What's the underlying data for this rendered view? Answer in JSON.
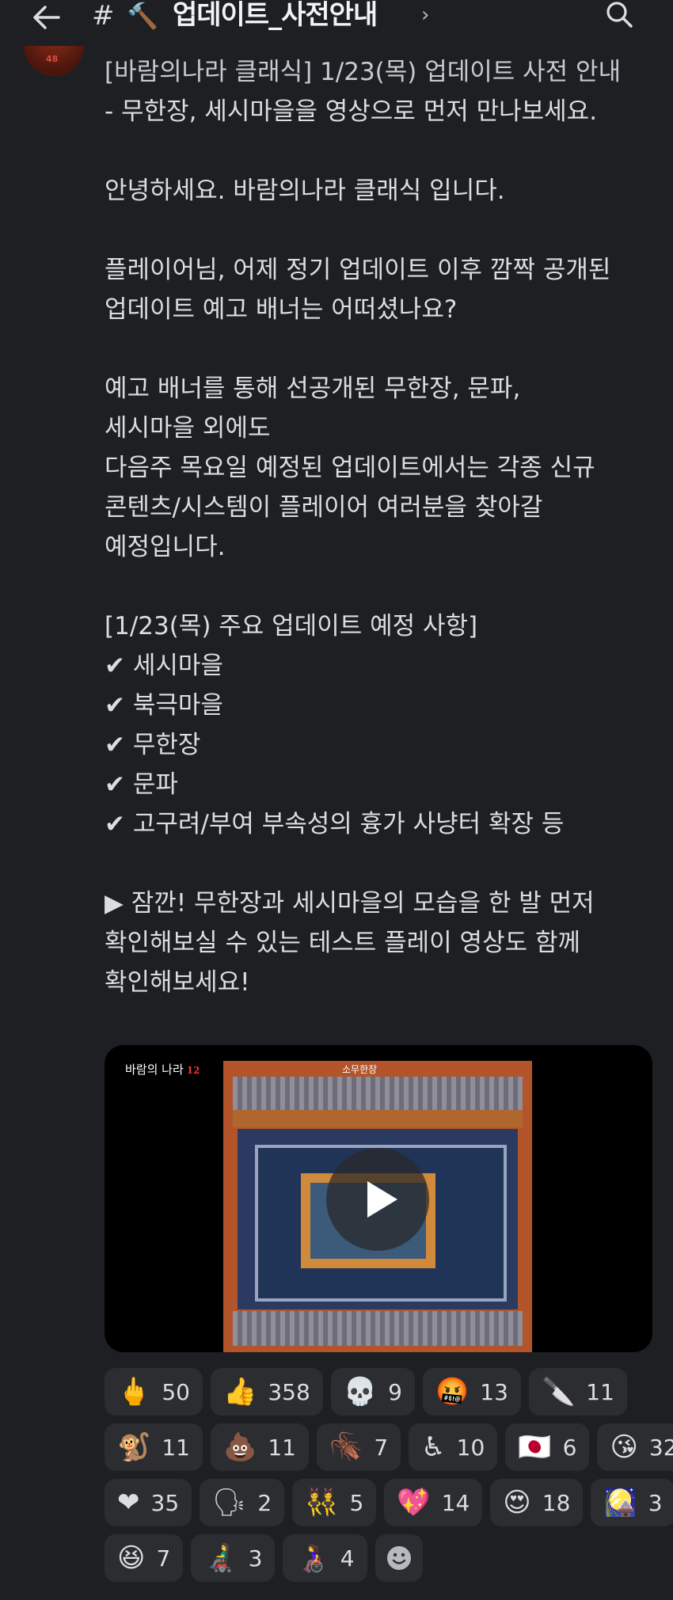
{
  "header": {
    "hash": "#",
    "icon": "🔨",
    "channel_name": "업데이트_사전안내",
    "chevron": "›"
  },
  "message": {
    "lines": [
      "[바람의나라 클래식] 1/23(목) 업데이트 사전 안내",
      "- 무한장, 세시마을을 영상으로 먼저 만나보세요.",
      "",
      "안녕하세요. 바람의나라 클래식 입니다.",
      "",
      "플레이어님, 어제 정기 업데이트 이후 깜짝 공개된",
      "업데이트 예고 배너는 어떠셨나요?",
      "",
      "예고 배너를 통해 선공개된 무한장, 문파,",
      "세시마을 외에도",
      "다음주 목요일 예정된 업데이트에서는 각종 신규",
      "콘텐츠/시스템이 플레이어 여러분을 찾아갈",
      "예정입니다.",
      "",
      "[1/23(목) 주요 업데이트 예정 사항]",
      "✔ 세시마을",
      "✔ 북극마을",
      "✔ 무한장",
      "✔ 문파",
      "✔ 고구려/부여 부속성의 흉가 사냥터 확장 등",
      "",
      "▶ 잠깐! 무한장과 세시마을의 모습을 한 발 먼저",
      "확인해보실 수 있는 테스트 플레이 영상도 함께",
      "확인해보세요!"
    ]
  },
  "video": {
    "logo_text": "바람의 나라",
    "logo_badge": "12",
    "scene_title": "소무한장"
  },
  "reactions": [
    [
      {
        "emoji": "🖕",
        "count": "50"
      },
      {
        "emoji": "👍",
        "count": "358"
      },
      {
        "emoji": "💀",
        "count": "9"
      },
      {
        "emoji": "🤬",
        "count": "13"
      },
      {
        "emoji": "🔪",
        "count": "11"
      }
    ],
    [
      {
        "emoji": "🐒",
        "count": "11"
      },
      {
        "emoji": "💩",
        "count": "11"
      },
      {
        "emoji": "🪳",
        "count": "7"
      },
      {
        "emoji": "♿",
        "count": "10"
      },
      {
        "emoji": "🇯🇵",
        "count": "6"
      },
      {
        "emoji": "😘",
        "count": "32"
      }
    ],
    [
      {
        "emoji": "❤",
        "count": "35"
      },
      {
        "emoji": "🗣",
        "count": "2"
      },
      {
        "emoji": "👯",
        "count": "5"
      },
      {
        "emoji": "💖",
        "count": "14"
      },
      {
        "emoji": "😍",
        "count": "18"
      },
      {
        "emoji": "🎑",
        "count": "3"
      }
    ],
    [
      {
        "emoji": "😆",
        "count": "7"
      },
      {
        "emoji": "👨‍🦼",
        "count": "3"
      },
      {
        "emoji": "👩‍🦽",
        "count": "4"
      }
    ]
  ],
  "colors": {
    "background": "#1e1f22",
    "chip": "#2b2d31",
    "text": "#dbdee1"
  }
}
